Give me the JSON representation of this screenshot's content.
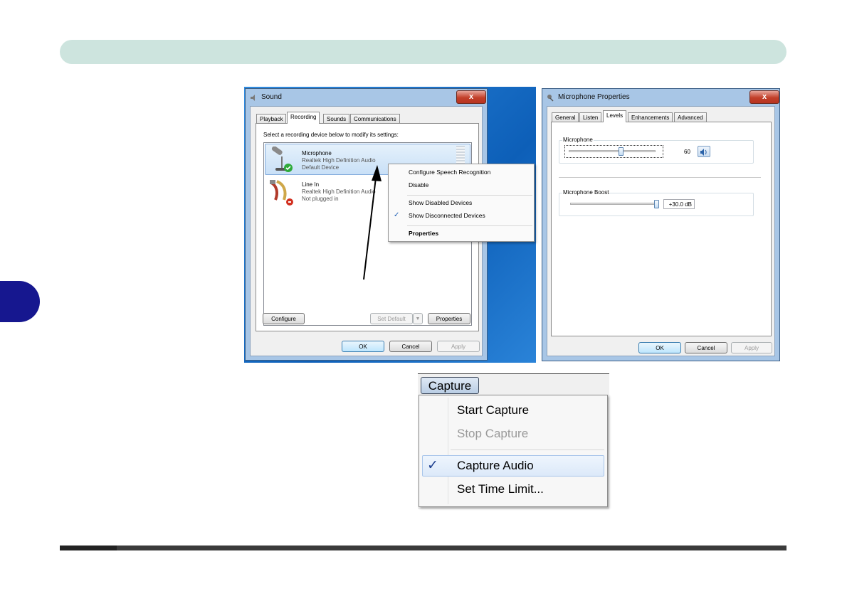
{
  "sound_dialog": {
    "title": "Sound",
    "close": "x",
    "tabs": [
      "Playback",
      "Recording",
      "Sounds",
      "Communications"
    ],
    "active_tab": "Recording",
    "instruction": "Select a recording device below to modify its settings:",
    "devices": [
      {
        "name": "Microphone",
        "driver": "Realtek High Definition Audio",
        "status": "Default Device"
      },
      {
        "name": "Line In",
        "driver": "Realtek High Definition Audio",
        "status": "Not plugged in"
      }
    ],
    "context_menu": {
      "items": [
        "Configure Speech Recognition",
        "Disable",
        "Show Disabled Devices",
        "Show Disconnected Devices",
        "Properties"
      ],
      "checked_item": "Show Disconnected Devices",
      "check_mark": "✓"
    },
    "buttons": {
      "configure": "Configure",
      "set_default": "Set Default",
      "properties": "Properties",
      "ok": "OK",
      "cancel": "Cancel",
      "apply": "Apply"
    }
  },
  "mic_dialog": {
    "title": "Microphone Properties",
    "close": "x",
    "tabs": [
      "General",
      "Listen",
      "Levels",
      "Enhancements",
      "Advanced"
    ],
    "active_tab": "Levels",
    "microphone": {
      "label": "Microphone",
      "value": "60",
      "level": 0.6
    },
    "boost": {
      "label": "Microphone Boost",
      "value": "+30.0 dB",
      "level": 1.0
    },
    "buttons": {
      "ok": "OK",
      "cancel": "Cancel",
      "apply": "Apply"
    }
  },
  "capture_menu": {
    "menu_label": "Capture",
    "items": [
      "Start Capture",
      "Stop Capture",
      "Capture Audio",
      "Set Time Limit..."
    ],
    "disabled_item": "Stop Capture",
    "checked_item": "Capture Audio",
    "check_mark": "✓"
  },
  "colors": {
    "header": "#cde4de",
    "side_tab": "#16178f",
    "footer_line": "#3b3b3b",
    "desktop": "#1a73d1"
  }
}
